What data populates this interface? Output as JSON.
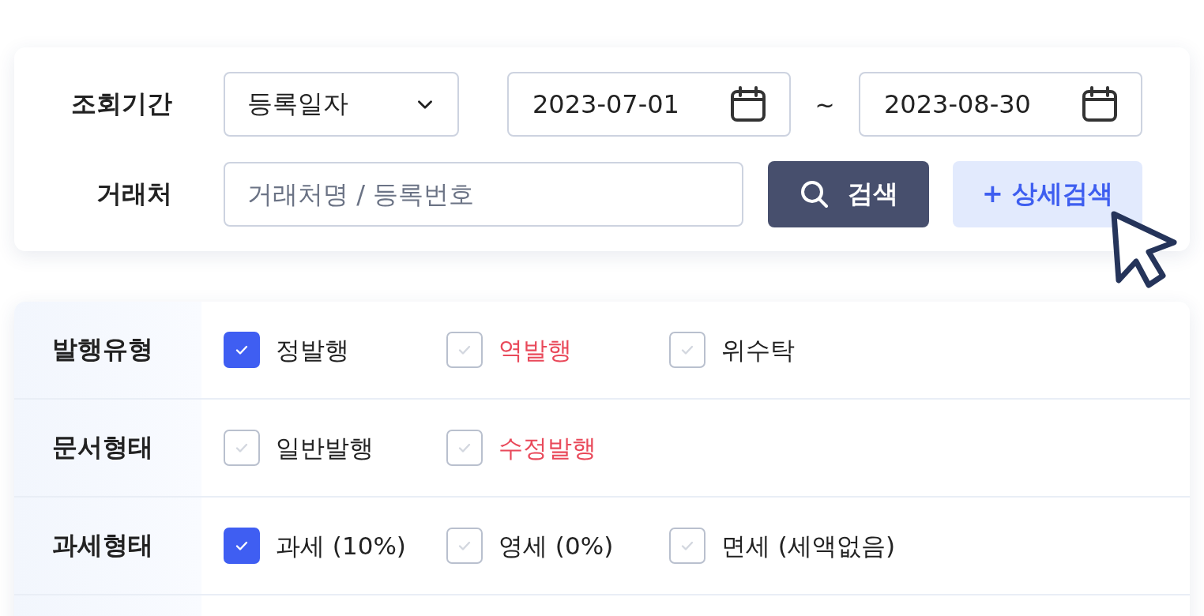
{
  "search_panel": {
    "period": {
      "label": "조회기간",
      "date_type": "등록일자",
      "start_date": "2023-07-01",
      "separator": "~",
      "end_date": "2023-08-30"
    },
    "partner": {
      "label": "거래처",
      "placeholder": "거래처명 / 등록번호"
    },
    "search_button": "검색",
    "detail_button": {
      "icon": "+",
      "label": "상세검색"
    }
  },
  "filters": [
    {
      "label": "발행유형",
      "options": [
        {
          "label": "정발행",
          "checked": true,
          "color": "#222222"
        },
        {
          "label": "역발행",
          "checked": false,
          "color": "#e9495a"
        },
        {
          "label": "위수탁",
          "checked": false,
          "color": "#222222"
        }
      ]
    },
    {
      "label": "문서형태",
      "options": [
        {
          "label": "일반발행",
          "checked": false,
          "color": "#222222"
        },
        {
          "label": "수정발행",
          "checked": false,
          "color": "#e9495a"
        }
      ]
    },
    {
      "label": "과세형태",
      "options": [
        {
          "label": "과세 (10%)",
          "checked": true,
          "color": "#222222"
        },
        {
          "label": "영세 (0%)",
          "checked": false,
          "color": "#222222"
        },
        {
          "label": "면세 (세액없음)",
          "checked": false,
          "color": "#222222"
        }
      ]
    }
  ]
}
